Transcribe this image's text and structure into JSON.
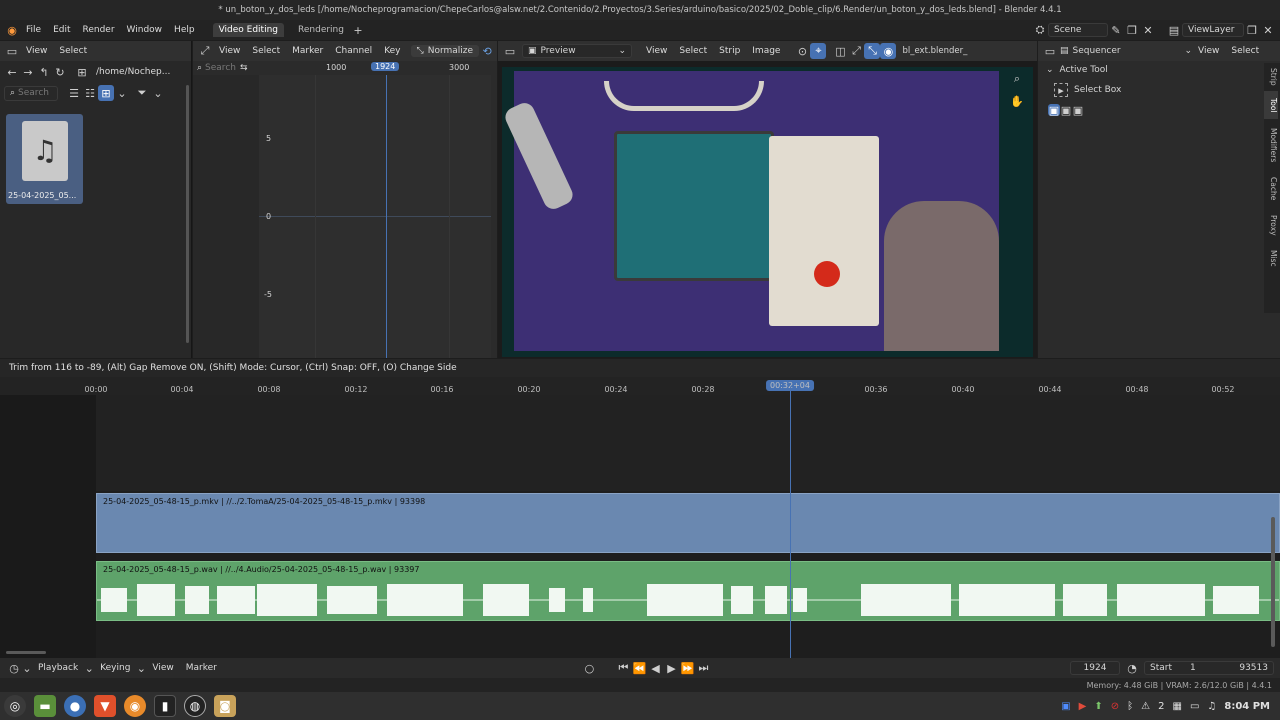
{
  "window": {
    "title": "* un_boton_y_dos_leds [/home/Nocheprogramacion/ChepeCarlos@alsw.net/2.Contenido/2.Proyectos/3.Series/arduino/basico/2025/02_Doble_clip/6.Render/un_boton_y_dos_leds.blend] - Blender 4.4.1"
  },
  "topmenu": {
    "items": [
      "File",
      "Edit",
      "Render",
      "Window",
      "Help"
    ],
    "workspaces": [
      "Video Editing",
      "Rendering"
    ],
    "scene": "Scene",
    "view_layer": "ViewLayer"
  },
  "filebrowser": {
    "menus": [
      "View",
      "Select"
    ],
    "path": "/home/Nochep...",
    "search_placeholder": "Search",
    "file_name": "25-04-2025_05..."
  },
  "graph": {
    "menus": [
      "View",
      "Select",
      "Marker",
      "Channel",
      "Key"
    ],
    "normalize": "Normalize",
    "search_placeholder": "Search",
    "ruler": [
      "1000",
      "1924",
      "3000"
    ],
    "yticks": [
      "5",
      "0",
      "-5"
    ]
  },
  "preview": {
    "mode": "Preview",
    "menus": [
      "View",
      "Select",
      "Strip",
      "Image"
    ],
    "ext_label": "bl_ext.blender_"
  },
  "props": {
    "editor": "Sequencer",
    "menus": [
      "View",
      "Select"
    ],
    "active_tool": "Active Tool",
    "tool_name": "Select Box",
    "tabs": [
      "Strip",
      "Tool",
      "Modifiers",
      "Cache",
      "Proxy",
      "Misc"
    ]
  },
  "trim_status": "Trim from 116 to -89, (Alt) Gap Remove ON, (Shift) Mode: Cursor, (Ctrl) Snap: OFF, (O) Change Side",
  "sequencer": {
    "ruler": [
      "00:00",
      "00:04",
      "00:08",
      "00:12",
      "00:16",
      "00:20",
      "00:24",
      "00:28",
      "00:32+04",
      "00:36",
      "00:40",
      "00:44",
      "00:48",
      "00:52"
    ],
    "current_time": "00:32+04",
    "video_strip": "25-04-2025_05-48-15_p.mkv | //../2.TomaA/25-04-2025_05-48-15_p.mkv | 93398",
    "audio_strip": "25-04-2025_05-48-15_p.wav | //../4.Audio/25-04-2025_05-48-15_p.wav | 93397",
    "video_color": "#6a88b0",
    "audio_color": "#5ea36a"
  },
  "playbar": {
    "menus": [
      "Playback",
      "Keying",
      "View",
      "Marker"
    ],
    "current_frame": "1924",
    "start_label": "Start",
    "start_value": "1",
    "end_value": "93513"
  },
  "statusbar": {
    "text": "Memory: 4.48 GiB | VRAM: 2.6/12.0 GiB | 4.4.1"
  },
  "taskbar": {
    "workspace_count": "2",
    "clock": "8:04 PM",
    "desk_num": "2"
  }
}
